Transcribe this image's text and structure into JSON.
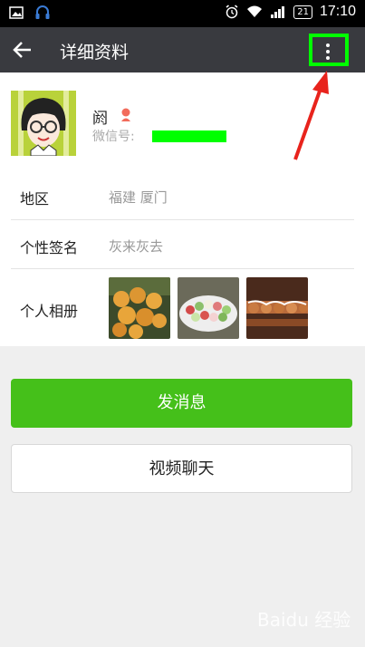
{
  "status_bar": {
    "battery": "21",
    "time": "17:10"
  },
  "header": {
    "title": "详细资料"
  },
  "profile": {
    "name": "阏",
    "wechat_id_label": "微信号:"
  },
  "info_rows": [
    {
      "label": "地区",
      "value": "福建  厦门"
    },
    {
      "label": "个性签名",
      "value": "灰来灰去"
    },
    {
      "label": "个人相册"
    }
  ],
  "buttons": {
    "send_message": "发消息",
    "video_chat": "视频聊天"
  },
  "watermark": "Baidu 经验",
  "colors": {
    "title_bar": "#393a3f",
    "primary_button": "#45c01a",
    "highlight": "#00ff00",
    "annotation_arrow": "#e8231c"
  },
  "icons": [
    "image-icon",
    "headset-icon",
    "alarm-icon",
    "wifi-icon",
    "signal-icon",
    "back-arrow-icon",
    "more-menu-icon",
    "female-icon"
  ]
}
